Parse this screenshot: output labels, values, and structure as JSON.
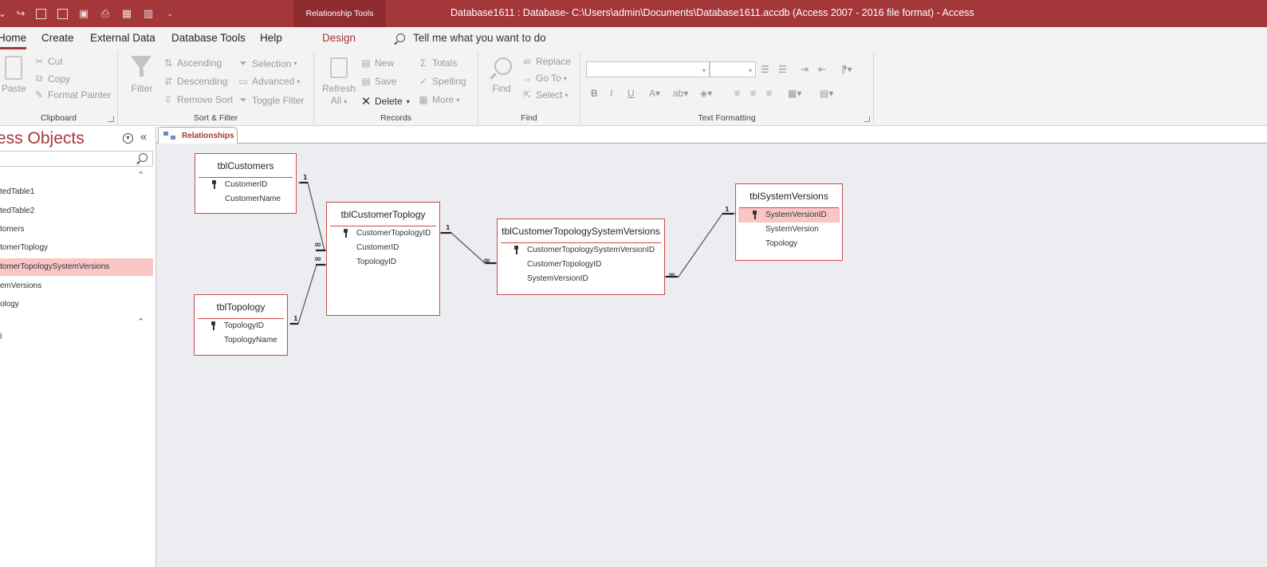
{
  "window": {
    "context_tab": "Relationship Tools",
    "title": "Database1611 : Database- C:\\Users\\admin\\Documents\\Database1611.accdb (Access 2007 - 2016 file format)  -  Access"
  },
  "tabs": {
    "home": "Home",
    "create": "Create",
    "external_data": "External Data",
    "database_tools": "Database Tools",
    "help": "Help",
    "design": "Design",
    "tell_me": "Tell me what you want to do"
  },
  "ribbon": {
    "clipboard": {
      "label": "Clipboard",
      "paste": "Paste",
      "cut": "Cut",
      "copy": "Copy",
      "format_painter": "Format Painter"
    },
    "sort_filter": {
      "label": "Sort & Filter",
      "filter": "Filter",
      "ascending": "Ascending",
      "descending": "Descending",
      "remove_sort": "Remove Sort",
      "selection": "Selection",
      "advanced": "Advanced",
      "toggle_filter": "Toggle Filter"
    },
    "records": {
      "label": "Records",
      "refresh": "Refresh",
      "refresh_all": "All",
      "new": "New",
      "save": "Save",
      "delete": "Delete",
      "totals": "Totals",
      "spelling": "Spelling",
      "more": "More"
    },
    "find": {
      "label": "Find",
      "find": "Find",
      "replace": "Replace",
      "go_to": "Go To",
      "select": "Select"
    },
    "text_formatting": {
      "label": "Text Formatting",
      "bold": "B",
      "italic": "I",
      "underline": "U"
    }
  },
  "nav": {
    "title": "ess Objects",
    "items": [
      {
        "label": "tedTable1"
      },
      {
        "label": "tedTable2"
      },
      {
        "label": "tomers"
      },
      {
        "label": "tomerToplogy"
      },
      {
        "label": "tomerTopologySystemVersions"
      },
      {
        "label": "emVersions"
      },
      {
        "label": "ology"
      }
    ],
    "stub": "l"
  },
  "document": {
    "tab_label": "Relationships",
    "tables": {
      "customers": {
        "title": "tblCustomers",
        "fields": [
          "CustomerID",
          "CustomerName"
        ]
      },
      "topology": {
        "title": "tblTopology",
        "fields": [
          "TopologyID",
          "TopologyName"
        ]
      },
      "customer_topology": {
        "title": "tblCustomerToplogy",
        "fields": [
          "CustomerTopologyID",
          "CustomerID",
          "TopologyID"
        ]
      },
      "ctsv": {
        "title": "tblCustomerTopologySystemVersions",
        "fields": [
          "CustomerTopologySystemVersionID",
          "CustomerTopologyID",
          "SystemVersionID"
        ]
      },
      "system_versions": {
        "title": "tblSystemVersions",
        "fields": [
          "SystemVersionID",
          "SystemVersion",
          "Topology"
        ]
      }
    },
    "relationships": {
      "one": "1",
      "many": "∞"
    }
  },
  "colors": {
    "accent": "#a4373a",
    "highlight": "#f9c6c5",
    "canvas": "#ecedf0"
  }
}
